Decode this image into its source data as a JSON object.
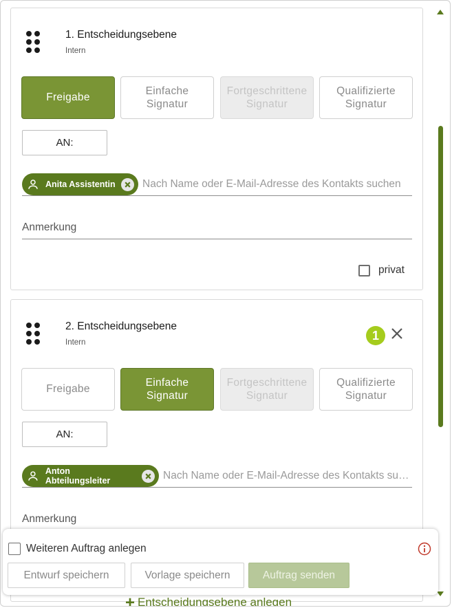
{
  "levels": [
    {
      "title": "1. Entscheidungsebene",
      "subtitle": "Intern",
      "types": [
        "Freigabe",
        "Einfache Signatur",
        "Fortgeschrittene Signatur",
        "Qualifizierte Signatur"
      ],
      "selected_type": "Freigabe",
      "to_label": "AN:",
      "recipient": "Anita Assistentin",
      "search_placeholder": "Nach Name oder E-Mail-Adresse des Kontakts suchen",
      "remark_label": "Anmerkung",
      "private_label": "privat"
    },
    {
      "title": "2. Entscheidungsebene",
      "subtitle": "Intern",
      "badge": "1",
      "types": [
        "Freigabe",
        "Einfache Signatur",
        "Fortgeschrittene Signatur",
        "Qualifizierte Signatur"
      ],
      "selected_type": "Einfache Signatur",
      "to_label": "AN:",
      "recipient": "Anton Abteilungsleiter",
      "search_placeholder": "Nach Name oder E-Mail-Adresse des Kontakts suchen",
      "remark_label": "Anmerkung"
    }
  ],
  "add_level_label": "Entscheidungsebene anlegen",
  "footer": {
    "further_order_label": "Weiteren Auftrag anlegen",
    "save_draft_label": "Entwurf speichern",
    "save_template_label": "Vorlage speichern",
    "send_order_label": "Auftrag senden"
  },
  "colors": {
    "accent": "#7a9535",
    "accent_dark": "#5a7a1e",
    "badge": "#a5cc1d",
    "disabled_send": "#b7c89a",
    "info": "#c0392b"
  },
  "icons": [
    "drag-handle-icon",
    "person-icon",
    "remove-chip-icon",
    "close-icon",
    "info-icon",
    "plus-icon"
  ]
}
